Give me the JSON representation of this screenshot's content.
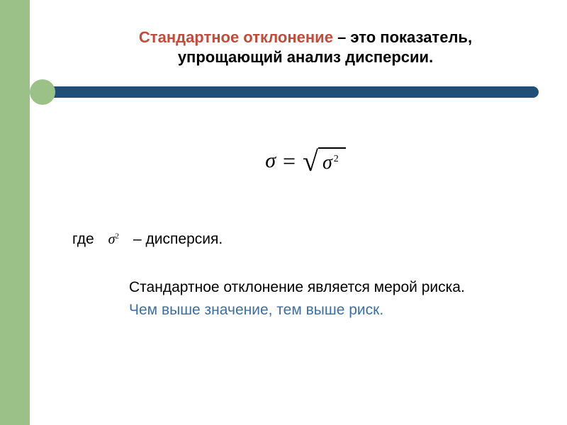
{
  "title": {
    "highlighted": "Стандартное отклонение",
    "rest1": " – это показатель,",
    "line2": "упрощающий анализ дисперсии."
  },
  "formula": {
    "lhs": "σ",
    "equals": "=",
    "sqrt_inner": "σ",
    "exponent": "2"
  },
  "where": {
    "label": "где",
    "symbol": "σ",
    "exponent": "2",
    "definition": " – дисперсия."
  },
  "body": {
    "line1": "Стандартное отклонение является мерой риска.",
    "line2": "Чем выше значение, тем выше риск."
  }
}
